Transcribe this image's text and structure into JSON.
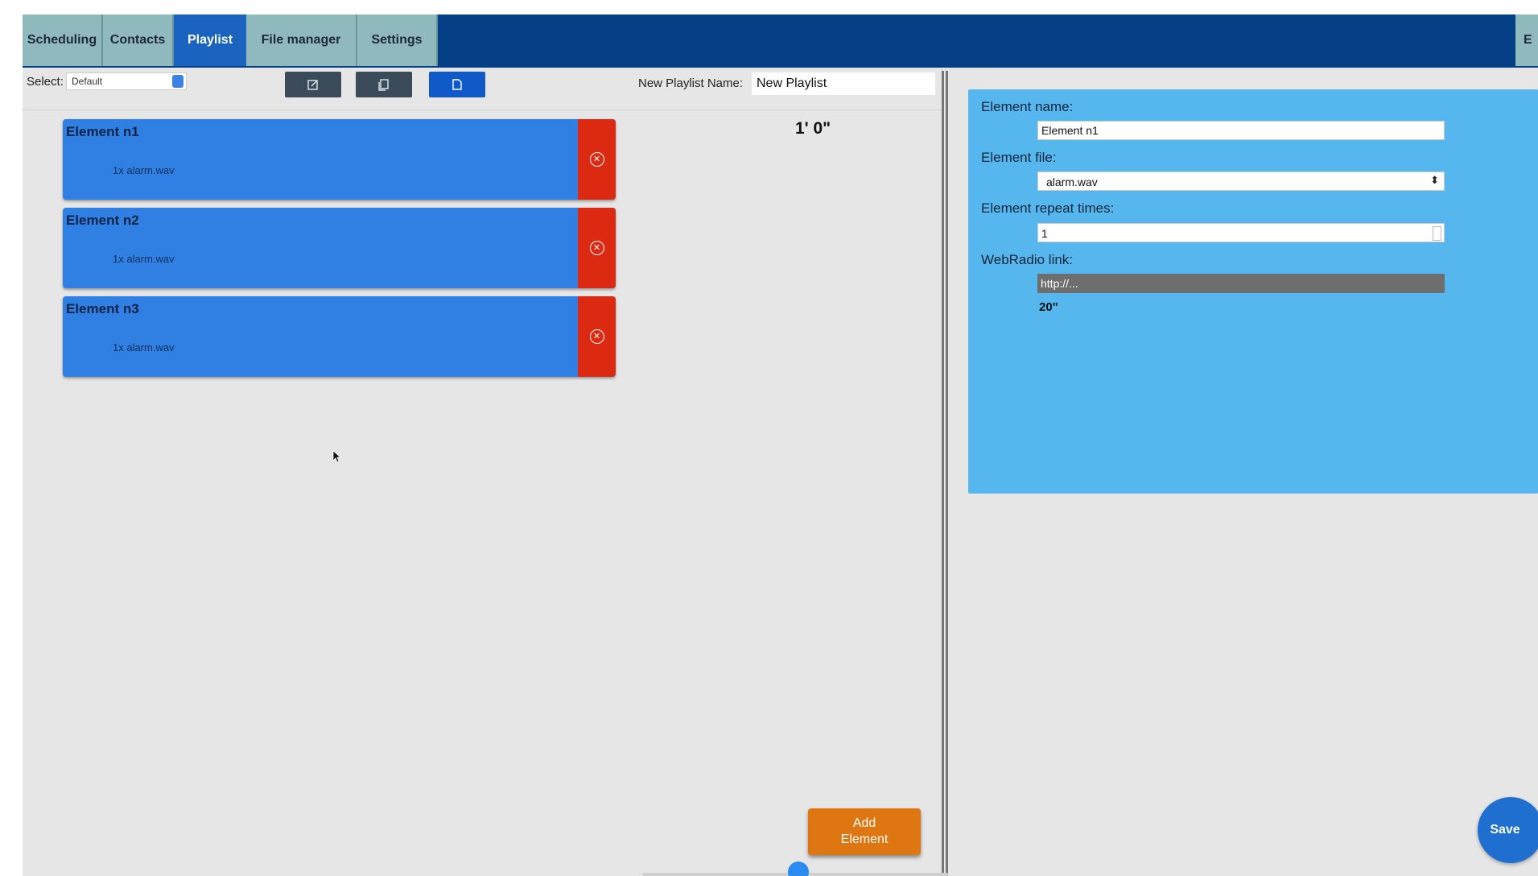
{
  "nav": {
    "tabs": [
      {
        "label": "Scheduling"
      },
      {
        "label": "Contacts"
      },
      {
        "label": "Playlist"
      },
      {
        "label": "File manager"
      },
      {
        "label": "Settings"
      }
    ],
    "edge_tab_label": "E"
  },
  "toolbar": {
    "select_label": "Select:",
    "select_value": "Default",
    "new_playlist_label": "New Playlist Name:",
    "new_playlist_value": "New Playlist",
    "buttons": [
      {
        "icon": "edit-icon"
      },
      {
        "icon": "copy-icon"
      },
      {
        "icon": "new-file-icon"
      }
    ]
  },
  "playlist": {
    "total_duration": "1' 0\"",
    "elements": [
      {
        "title": "Element n1",
        "file": "1x alarm.wav"
      },
      {
        "title": "Element n2",
        "file": "1x alarm.wav"
      },
      {
        "title": "Element n3",
        "file": "1x alarm.wav"
      }
    ],
    "add_button_line1": "Add",
    "add_button_line2": "Element"
  },
  "editor": {
    "name_label": "Element name:",
    "name_value": "Element n1",
    "file_label": "Element file:",
    "file_value": "alarm.wav",
    "repeat_label": "Element repeat times:",
    "repeat_value": "1",
    "webradio_label": "WebRadio link:",
    "webradio_placeholder": "http://...",
    "interval": "20\""
  },
  "save_label": "Save",
  "colors": {
    "nav_bg": "#053f86",
    "tab_inactive": "#8fb9bd",
    "tab_active": "#1a64c0",
    "element_blue": "#3080e3",
    "delete_red": "#dc2a12",
    "panel_blue": "#56b6ee",
    "add_orange": "#de7611",
    "save_blue": "#1e6fd0"
  }
}
